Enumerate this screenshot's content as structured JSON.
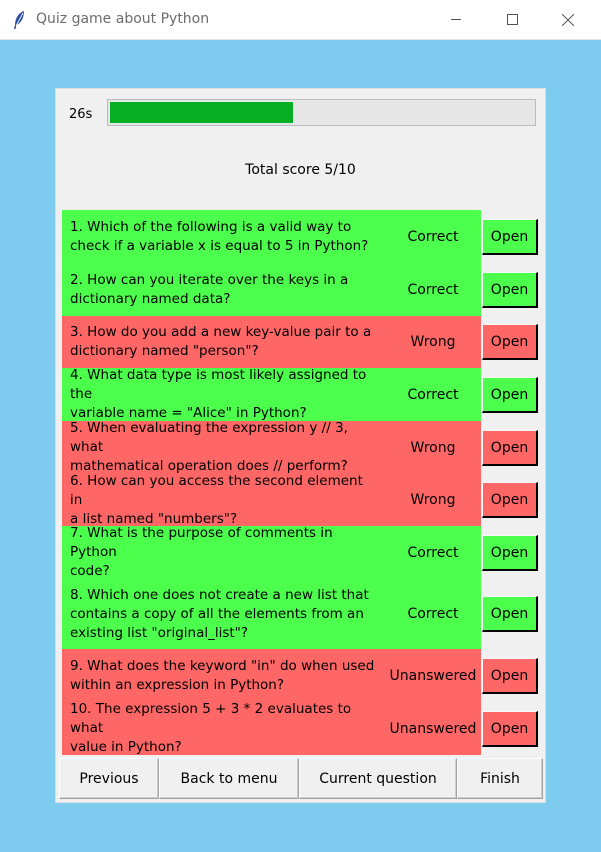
{
  "window": {
    "title": "Quiz game about Python",
    "icon": "feather-icon"
  },
  "timer": {
    "label": "26s",
    "progress_fraction": 0.43,
    "fill_color": "#06b025"
  },
  "score": {
    "label": "Total score 5/10"
  },
  "colors": {
    "correct": "#4cff4c",
    "wrong": "#ff6666",
    "background": "#7ecbf0"
  },
  "questions": [
    {
      "lines": [
        "1. Which of the following is a valid way to",
        "check if a variable x is equal to 5 in Python?"
      ],
      "status": "Correct",
      "open_label": "Open"
    },
    {
      "lines": [
        "2. How can you iterate over the keys in a",
        "dictionary named data?"
      ],
      "status": "Correct",
      "open_label": "Open"
    },
    {
      "lines": [
        "3. How do you add a new key-value pair to a",
        "dictionary named \"person\"?"
      ],
      "status": "Wrong",
      "open_label": "Open"
    },
    {
      "lines": [
        "4. What data type is most likely assigned to the",
        "variable name = \"Alice\" in Python?"
      ],
      "status": "Correct",
      "open_label": "Open"
    },
    {
      "lines": [
        "5. When evaluating the expression y // 3, what",
        "mathematical operation does // perform?"
      ],
      "status": "Wrong",
      "open_label": "Open"
    },
    {
      "lines": [
        "6. How can you access the second element in",
        "a list named \"numbers\"?"
      ],
      "status": "Wrong",
      "open_label": "Open"
    },
    {
      "lines": [
        "7. What is the purpose of comments in Python",
        "code?"
      ],
      "status": "Correct",
      "open_label": "Open"
    },
    {
      "lines": [
        "8. Which one does not create a new list that",
        "contains a copy of all the elements from an",
        "existing list \"original_list\"?"
      ],
      "status": "Correct",
      "open_label": "Open"
    },
    {
      "lines": [
        "9. What does the keyword \"in\" do when used",
        "within an expression in Python?"
      ],
      "status": "Unanswered",
      "open_label": "Open"
    },
    {
      "lines": [
        "10. The expression 5 + 3 * 2 evaluates to what",
        "value in Python?"
      ],
      "status": "Unanswered",
      "open_label": "Open"
    }
  ],
  "nav": {
    "previous": "Previous",
    "back_to_menu": "Back to menu",
    "current_question": "Current question",
    "finish": "Finish"
  }
}
